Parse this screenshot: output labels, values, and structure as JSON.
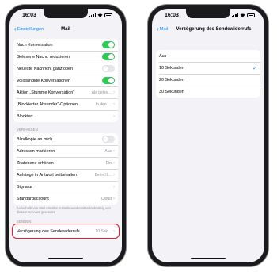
{
  "status": {
    "time": "16:03"
  },
  "left": {
    "back_label": "Einstellungen",
    "title": "Mail",
    "group1": [
      {
        "label": "Nach Konversation",
        "toggle": "on"
      },
      {
        "label": "Gelesene Nachr. reduzieren",
        "toggle": "on"
      },
      {
        "label": "Neueste Nachricht ganz oben",
        "toggle": "off"
      },
      {
        "label": "Vollständige Konversationen",
        "toggle": "on"
      },
      {
        "label": "Aktion „Stumme Konversation“",
        "value": "Als geles…"
      },
      {
        "label": "„Blockierter Absender“-Optionen",
        "value": "In den …"
      },
      {
        "label": "Blockiert",
        "value": ""
      }
    ],
    "section2_header": "VERFASSEN",
    "group2": [
      {
        "label": "Blindkopie an mich",
        "toggle": "off"
      },
      {
        "label": "Adressen markieren",
        "value": "Aus"
      },
      {
        "label": "Zitatebene erhöhen",
        "value": "Ein"
      },
      {
        "label": "Anhänge in Antwort beibehalten",
        "value": "Beim H…"
      },
      {
        "label": "Signatur",
        "value": ""
      },
      {
        "label": "Standardaccount",
        "value": "iCloud"
      }
    ],
    "footnote": "Außerhalb von Mail erstellte E-Mails werden standardmäßig von diesem Account gesendet.",
    "section3_header": "SENDEN",
    "send_row": {
      "label": "Verzögerung des Sendewiderrufs",
      "value": "10 Sek…"
    }
  },
  "right": {
    "back_label": "Mail",
    "title": "Verzögerung des Sendewiderrufs",
    "options": [
      {
        "label": "Aus",
        "checked": false
      },
      {
        "label": "10 Sekunden",
        "checked": true
      },
      {
        "label": "20 Sekunden",
        "checked": false
      },
      {
        "label": "30 Sekunden",
        "checked": false
      }
    ],
    "check_glyph": "✓"
  },
  "colors": {
    "accent": "#0a84ff",
    "toggle_on": "#34c759",
    "highlight": "#e0202a"
  }
}
